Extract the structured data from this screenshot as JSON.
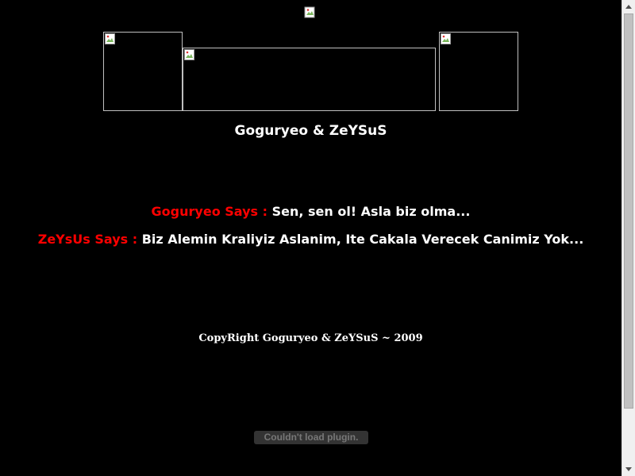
{
  "page": {
    "title": "Goguryeo & ZeYSuS",
    "messages": [
      {
        "speaker": "Goguryeo Says :",
        "text": "Sen, sen ol! Asla biz olma..."
      },
      {
        "speaker": "ZeYsUs Says :",
        "text": "Biz Alemin Kraliyiz Aslanim, Ite Cakala Verecek Canimiz Yok..."
      }
    ],
    "copyright": "CopyRight Goguryeo & ZeYSuS ~ 2009",
    "plugin_error": "Couldn't load plugin."
  },
  "colors": {
    "background": "#000000",
    "speaker": "#ff0000",
    "text": "#ffffff"
  }
}
